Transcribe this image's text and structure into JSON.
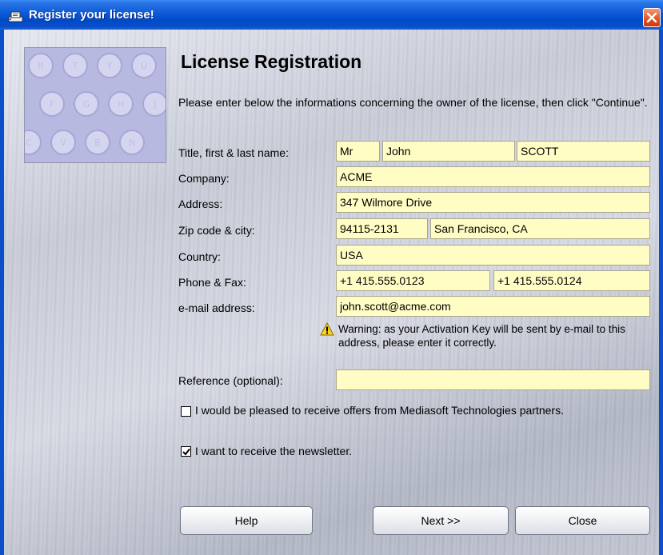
{
  "window": {
    "title": "Register your license!"
  },
  "heading": "License Registration",
  "intro": "Please enter below the informations concerning the owner of the license, then click \"Continue\".",
  "labels": {
    "name": "Title, first & last name:",
    "company": "Company:",
    "address": "Address:",
    "zip": "Zip code & city:",
    "country": "Country:",
    "phone": "Phone & Fax:",
    "email": "e-mail address:",
    "reference": "Reference (optional):"
  },
  "fields": {
    "title": "Mr",
    "first_name": "John",
    "last_name": "SCOTT",
    "company": "ACME",
    "address": "347 Wilmore Drive",
    "zip": "94115-2131",
    "city": "San Francisco, CA",
    "country": "USA",
    "phone": "+1 415.555.0123",
    "fax": "+1 415.555.0124",
    "email": "john.scott@acme.com",
    "reference": ""
  },
  "warning": "Warning: as your Activation Key will be sent by e-mail to this address, please enter it correctly.",
  "checkboxes": {
    "offers": {
      "label": "I would be pleased to receive offers from Mediasoft Technologies partners.",
      "checked": false
    },
    "newsletter": {
      "label": "I want to receive the newsletter.",
      "checked": true
    }
  },
  "buttons": {
    "help": "Help",
    "next": "Next >>",
    "close": "Close"
  },
  "logo_keys": [
    "R",
    "T",
    "Y",
    "U",
    "F",
    "G",
    "H",
    "J",
    "C",
    "V",
    "B",
    "N"
  ],
  "colors": {
    "field_bg": "#fffdc4",
    "title_bar": "#0b5ad8",
    "close_button": "#e3572a",
    "logo_bg": "#b8b9e0"
  },
  "icons": [
    "app-icon",
    "close-icon",
    "warning-icon",
    "check-icon"
  ]
}
